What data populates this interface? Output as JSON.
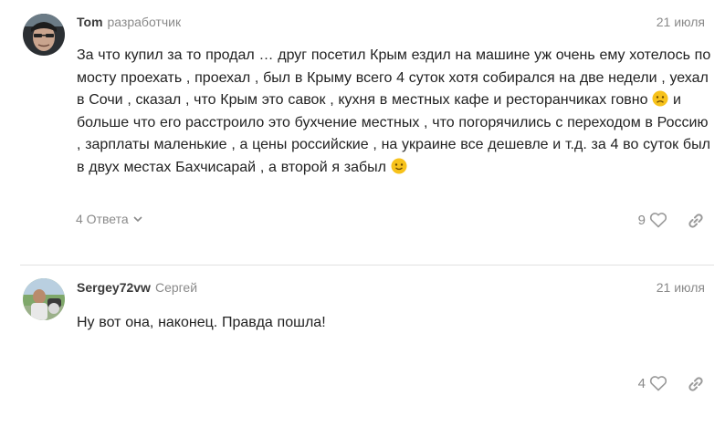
{
  "comments": [
    {
      "username": "Tom",
      "role": "разработчик",
      "date": "21 июля",
      "text_1": "За что купил за то продал … друг посетил Крым ездил на машине уж очень ему хотелось по мосту проехать , проехал , был в Крыму всего 4 суток хотя собирался на две недели , уехал в Сочи , сказал , что Крым это савок , кухня в местных кафе и ресторанчиках говно",
      "text_2": " и больше что его расстроило это бухчение местных , что погорячились с переходом в Россию , зарплаты маленькие , а цены российские , на украине все дешевле и т.д. за 4 во суток был в двух местах Бахчисарай , а второй я забыл",
      "replies_label": "4 Ответа",
      "likes": "9"
    },
    {
      "username": "Sergey72vw",
      "role": "Сергей",
      "date": "21 июля",
      "text_1": "Ну вот она, наконец. Правда пошла!",
      "likes": "4"
    }
  ],
  "icons": {
    "emoji_1": "frowning-emoji-icon",
    "emoji_2": "smiling-emoji-icon",
    "heart": "heart-outline-icon",
    "share": "link-share-icon",
    "chevron": "chevron-down-icon"
  },
  "colors": {
    "emoji": "#f7c21b",
    "muted": "#8a8a8a",
    "text": "#222222"
  }
}
